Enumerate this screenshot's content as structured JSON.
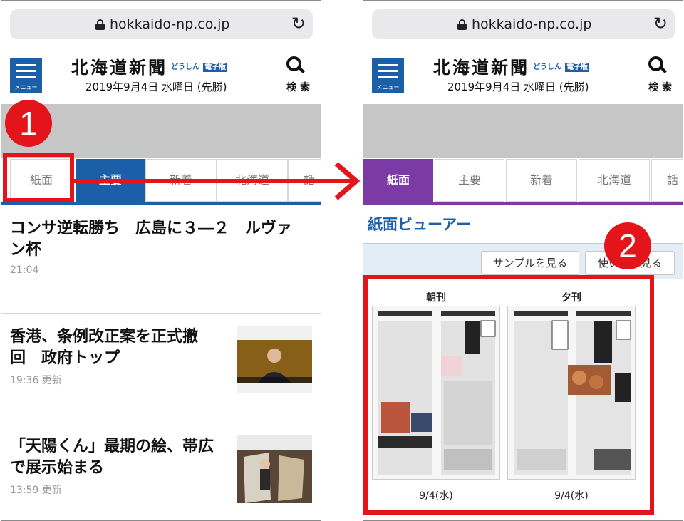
{
  "browser": {
    "url": "hokkaido-np.co.jp"
  },
  "header": {
    "menu_label": "メニュー",
    "logo_main": "北海道新聞",
    "logo_sub": "どうしん",
    "logo_tag": "電子版",
    "date_line": "2019年9月4日 水曜日 (先勝)",
    "search_label": "検 索"
  },
  "left_tabs": [
    {
      "label": "紙面"
    },
    {
      "label": "主要"
    },
    {
      "label": "新着"
    },
    {
      "label": "北海道"
    },
    {
      "label": "話"
    }
  ],
  "right_tabs": [
    {
      "label": "紙面"
    },
    {
      "label": "主要"
    },
    {
      "label": "新着"
    },
    {
      "label": "北海道"
    },
    {
      "label": "話"
    }
  ],
  "articles": [
    {
      "title_line1": "コンサ逆転勝ち　広島に３―２　ルヴァ",
      "title_line2": "ン杯",
      "time": "21:04"
    },
    {
      "title_line1": "香港、条例改正案を正式撤",
      "title_line2": "回　政府トップ",
      "time": "19:36 更新"
    },
    {
      "title_line1": "「天陽くん」最期の絵、帯広",
      "title_line2": "で展示始まる",
      "time": "13:59 更新"
    }
  ],
  "viewer": {
    "title": "紙面ビューアー",
    "sample_button": "サンプルを見る",
    "howto_button": "使い方を見る",
    "morning": {
      "label": "朝刊",
      "date": "9/4(水)"
    },
    "evening": {
      "label": "夕刊",
      "date": "9/4(水)"
    }
  },
  "callouts": {
    "step1": "1",
    "step2": "2"
  },
  "colors": {
    "brand_blue": "#1a5fa8",
    "tab_purple": "#7b3aa6",
    "callout_red": "#e3151a"
  }
}
